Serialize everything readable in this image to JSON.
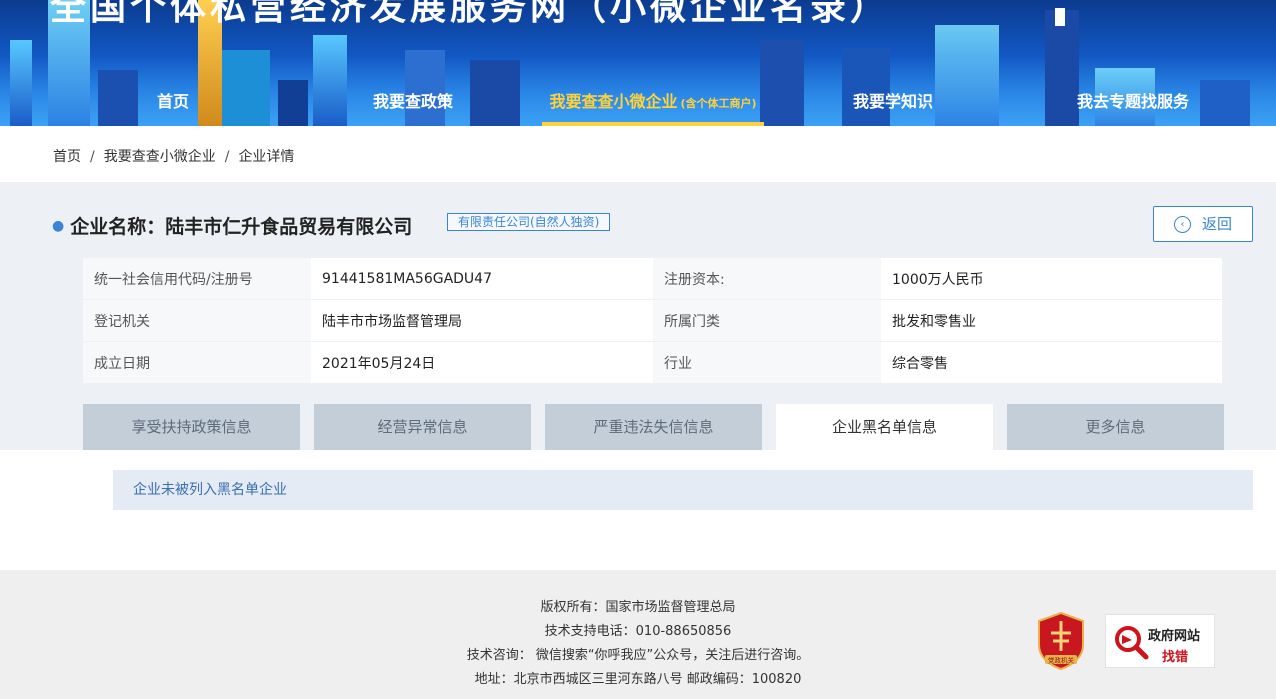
{
  "header": {
    "banner_title": "全国个体私营经济发展服务网（小微企业名录）",
    "nav": [
      {
        "label": "首页"
      },
      {
        "label": "我要查政策"
      },
      {
        "label": "我要查查小微企业",
        "sub": "(含个体工商户)",
        "active": true
      },
      {
        "label": "我要学知识"
      },
      {
        "label": "我去专题找服务"
      }
    ]
  },
  "breadcrumb": {
    "items": [
      "首页",
      "我要查查小微企业",
      "企业详情"
    ],
    "separator": "/"
  },
  "enterprise": {
    "name_label": "企业名称：",
    "name": "陆丰市仁升食品贸易有限公司",
    "type_badge": "有限责任公司(自然人独资)",
    "back_label": "返回",
    "rows": [
      {
        "k1": "统一社会信用代码/注册号",
        "v1": "91441581MA56GADU47",
        "k2": "注册资本:",
        "v2": "1000万人民币"
      },
      {
        "k1": "登记机关",
        "v1": "陆丰市市场监督管理局",
        "k2": "所属门类",
        "v2": "批发和零售业"
      },
      {
        "k1": "成立日期",
        "v1": "2021年05月24日",
        "k2": "行业",
        "v2": "综合零售"
      }
    ]
  },
  "tabs": [
    {
      "label": "享受扶持政策信息"
    },
    {
      "label": "经营异常信息"
    },
    {
      "label": "严重违法失信信息"
    },
    {
      "label": "企业黑名单信息",
      "active": true
    },
    {
      "label": "更多信息"
    }
  ],
  "content": {
    "notice": "企业未被列入黑名单企业"
  },
  "footer": {
    "copyright": "版权所有：国家市场监督管理总局",
    "support_phone": "技术支持电话：010-88650856",
    "consult": "技术咨询： 微信搜索“你呼我应”公众号，关注后进行咨询。",
    "address": "地址：北京市西城区三里河东路八号 邮政编码：100820",
    "badge_emblem_text": "党政机关",
    "badge_error_line1": "政府网站",
    "badge_error_line2": "找错"
  },
  "colors": {
    "accent": "#3a83d8",
    "nav_active": "#ffd23c",
    "banner_top": "#0b3b8f",
    "panel_bg": "#edf1f5",
    "tab_inactive": "#c4ced9",
    "notice_bg": "#e4ebf4",
    "footer_bg": "#efefef"
  }
}
